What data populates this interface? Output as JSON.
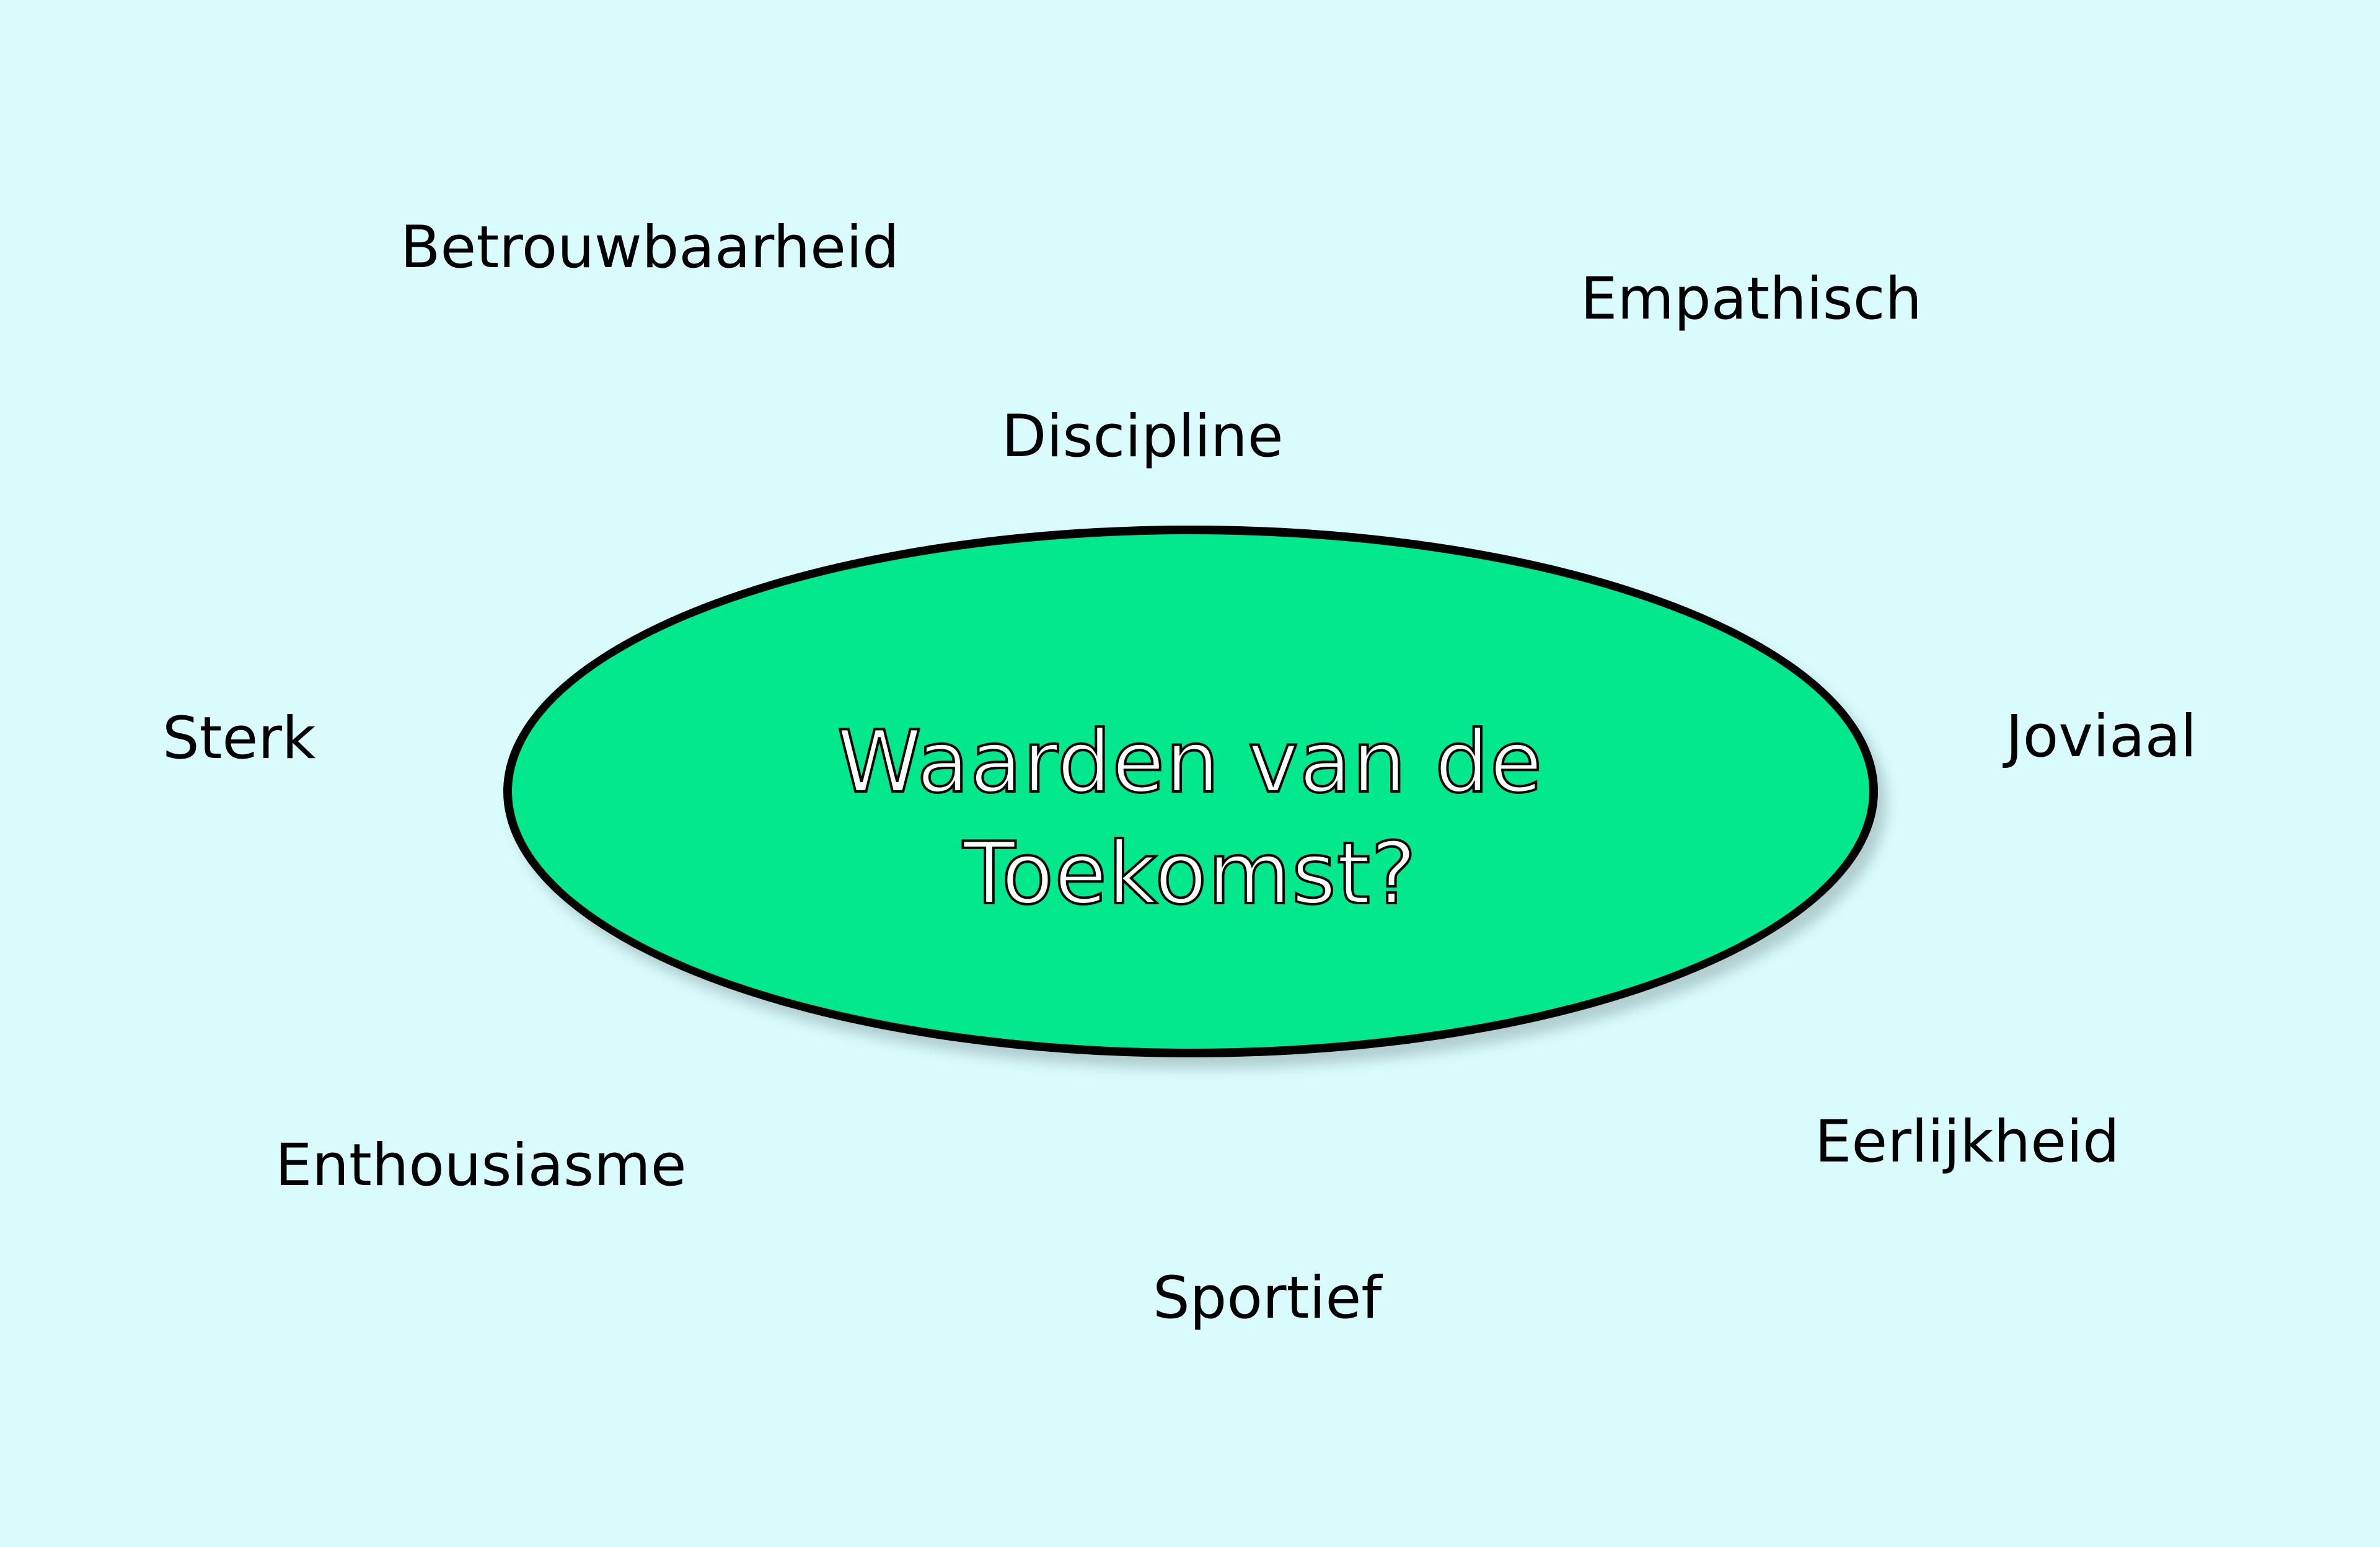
{
  "center": {
    "line1": "Waarden van de",
    "line2": "Toekomst?"
  },
  "values": {
    "betrouwbaarheid": "Betrouwbaarheid",
    "empathisch": "Empathisch",
    "discipline": "Discipline",
    "sterk": "Sterk",
    "joviaal": "Joviaal",
    "enthousiasme": "Enthousiasme",
    "eerlijkheid": "Eerlijkheid",
    "sportief": "Sportief"
  },
  "colors": {
    "background": "#d9fbfc",
    "ellipse_fill": "#03e88c",
    "ellipse_stroke": "#000000",
    "text": "#000000"
  }
}
